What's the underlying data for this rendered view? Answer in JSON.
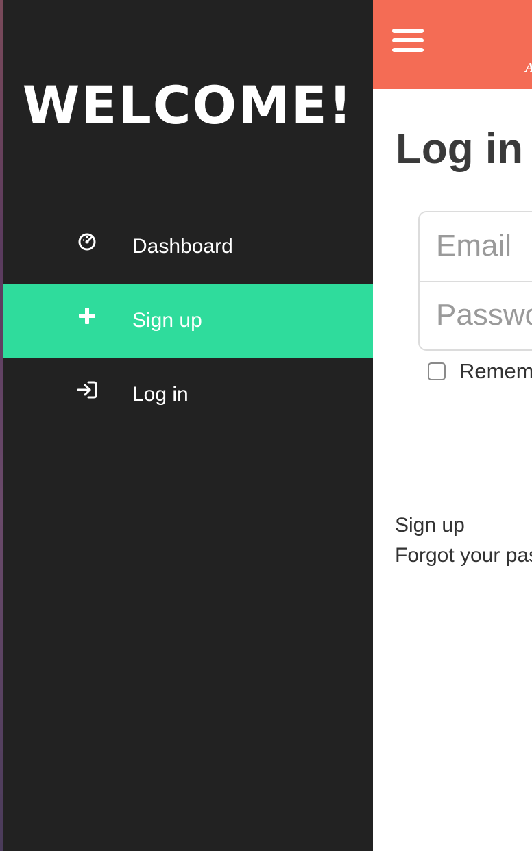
{
  "sidebar": {
    "welcome": "WELCOME!",
    "items": [
      {
        "label": "Dashboard",
        "icon": "dashboard-gauge-icon",
        "active": false
      },
      {
        "label": "Sign up",
        "icon": "plus-icon",
        "active": true
      },
      {
        "label": "Log in",
        "icon": "sign-in-icon",
        "active": false
      }
    ],
    "background": "#222222",
    "active_color": "#2fdc9c"
  },
  "header": {
    "menu_icon": "hamburger-menu-icon",
    "background": "#f46c55"
  },
  "main": {
    "title": "Log in",
    "email_placeholder": "Email",
    "password_placeholder": "Password",
    "remember_label": "Remember me",
    "links": {
      "sign_up": "Sign up",
      "forgot": "Forgot your password?"
    }
  }
}
